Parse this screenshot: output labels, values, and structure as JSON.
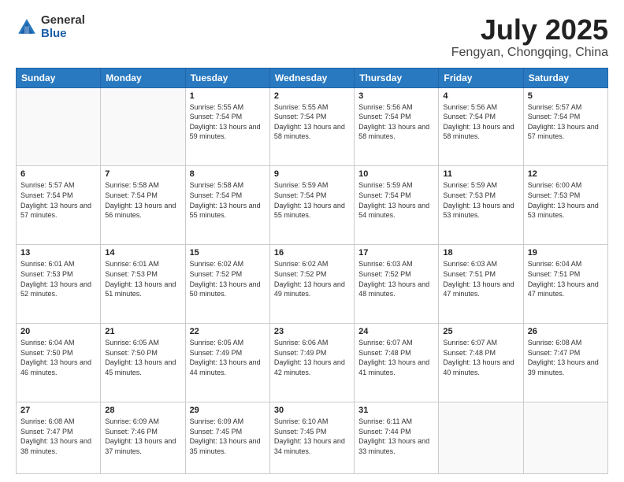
{
  "header": {
    "logo_general": "General",
    "logo_blue": "Blue",
    "month": "July 2025",
    "location": "Fengyan, Chongqing, China"
  },
  "days_of_week": [
    "Sunday",
    "Monday",
    "Tuesday",
    "Wednesday",
    "Thursday",
    "Friday",
    "Saturday"
  ],
  "weeks": [
    [
      {
        "day": "",
        "info": ""
      },
      {
        "day": "",
        "info": ""
      },
      {
        "day": "1",
        "sunrise": "5:55 AM",
        "sunset": "7:54 PM",
        "daylight": "13 hours and 59 minutes."
      },
      {
        "day": "2",
        "sunrise": "5:55 AM",
        "sunset": "7:54 PM",
        "daylight": "13 hours and 58 minutes."
      },
      {
        "day": "3",
        "sunrise": "5:56 AM",
        "sunset": "7:54 PM",
        "daylight": "13 hours and 58 minutes."
      },
      {
        "day": "4",
        "sunrise": "5:56 AM",
        "sunset": "7:54 PM",
        "daylight": "13 hours and 58 minutes."
      },
      {
        "day": "5",
        "sunrise": "5:57 AM",
        "sunset": "7:54 PM",
        "daylight": "13 hours and 57 minutes."
      }
    ],
    [
      {
        "day": "6",
        "sunrise": "5:57 AM",
        "sunset": "7:54 PM",
        "daylight": "13 hours and 57 minutes."
      },
      {
        "day": "7",
        "sunrise": "5:58 AM",
        "sunset": "7:54 PM",
        "daylight": "13 hours and 56 minutes."
      },
      {
        "day": "8",
        "sunrise": "5:58 AM",
        "sunset": "7:54 PM",
        "daylight": "13 hours and 55 minutes."
      },
      {
        "day": "9",
        "sunrise": "5:59 AM",
        "sunset": "7:54 PM",
        "daylight": "13 hours and 55 minutes."
      },
      {
        "day": "10",
        "sunrise": "5:59 AM",
        "sunset": "7:54 PM",
        "daylight": "13 hours and 54 minutes."
      },
      {
        "day": "11",
        "sunrise": "5:59 AM",
        "sunset": "7:53 PM",
        "daylight": "13 hours and 53 minutes."
      },
      {
        "day": "12",
        "sunrise": "6:00 AM",
        "sunset": "7:53 PM",
        "daylight": "13 hours and 53 minutes."
      }
    ],
    [
      {
        "day": "13",
        "sunrise": "6:01 AM",
        "sunset": "7:53 PM",
        "daylight": "13 hours and 52 minutes."
      },
      {
        "day": "14",
        "sunrise": "6:01 AM",
        "sunset": "7:53 PM",
        "daylight": "13 hours and 51 minutes."
      },
      {
        "day": "15",
        "sunrise": "6:02 AM",
        "sunset": "7:52 PM",
        "daylight": "13 hours and 50 minutes."
      },
      {
        "day": "16",
        "sunrise": "6:02 AM",
        "sunset": "7:52 PM",
        "daylight": "13 hours and 49 minutes."
      },
      {
        "day": "17",
        "sunrise": "6:03 AM",
        "sunset": "7:52 PM",
        "daylight": "13 hours and 48 minutes."
      },
      {
        "day": "18",
        "sunrise": "6:03 AM",
        "sunset": "7:51 PM",
        "daylight": "13 hours and 47 minutes."
      },
      {
        "day": "19",
        "sunrise": "6:04 AM",
        "sunset": "7:51 PM",
        "daylight": "13 hours and 47 minutes."
      }
    ],
    [
      {
        "day": "20",
        "sunrise": "6:04 AM",
        "sunset": "7:50 PM",
        "daylight": "13 hours and 46 minutes."
      },
      {
        "day": "21",
        "sunrise": "6:05 AM",
        "sunset": "7:50 PM",
        "daylight": "13 hours and 45 minutes."
      },
      {
        "day": "22",
        "sunrise": "6:05 AM",
        "sunset": "7:49 PM",
        "daylight": "13 hours and 44 minutes."
      },
      {
        "day": "23",
        "sunrise": "6:06 AM",
        "sunset": "7:49 PM",
        "daylight": "13 hours and 42 minutes."
      },
      {
        "day": "24",
        "sunrise": "6:07 AM",
        "sunset": "7:48 PM",
        "daylight": "13 hours and 41 minutes."
      },
      {
        "day": "25",
        "sunrise": "6:07 AM",
        "sunset": "7:48 PM",
        "daylight": "13 hours and 40 minutes."
      },
      {
        "day": "26",
        "sunrise": "6:08 AM",
        "sunset": "7:47 PM",
        "daylight": "13 hours and 39 minutes."
      }
    ],
    [
      {
        "day": "27",
        "sunrise": "6:08 AM",
        "sunset": "7:47 PM",
        "daylight": "13 hours and 38 minutes."
      },
      {
        "day": "28",
        "sunrise": "6:09 AM",
        "sunset": "7:46 PM",
        "daylight": "13 hours and 37 minutes."
      },
      {
        "day": "29",
        "sunrise": "6:09 AM",
        "sunset": "7:45 PM",
        "daylight": "13 hours and 35 minutes."
      },
      {
        "day": "30",
        "sunrise": "6:10 AM",
        "sunset": "7:45 PM",
        "daylight": "13 hours and 34 minutes."
      },
      {
        "day": "31",
        "sunrise": "6:11 AM",
        "sunset": "7:44 PM",
        "daylight": "13 hours and 33 minutes."
      },
      {
        "day": "",
        "info": ""
      },
      {
        "day": "",
        "info": ""
      }
    ]
  ]
}
